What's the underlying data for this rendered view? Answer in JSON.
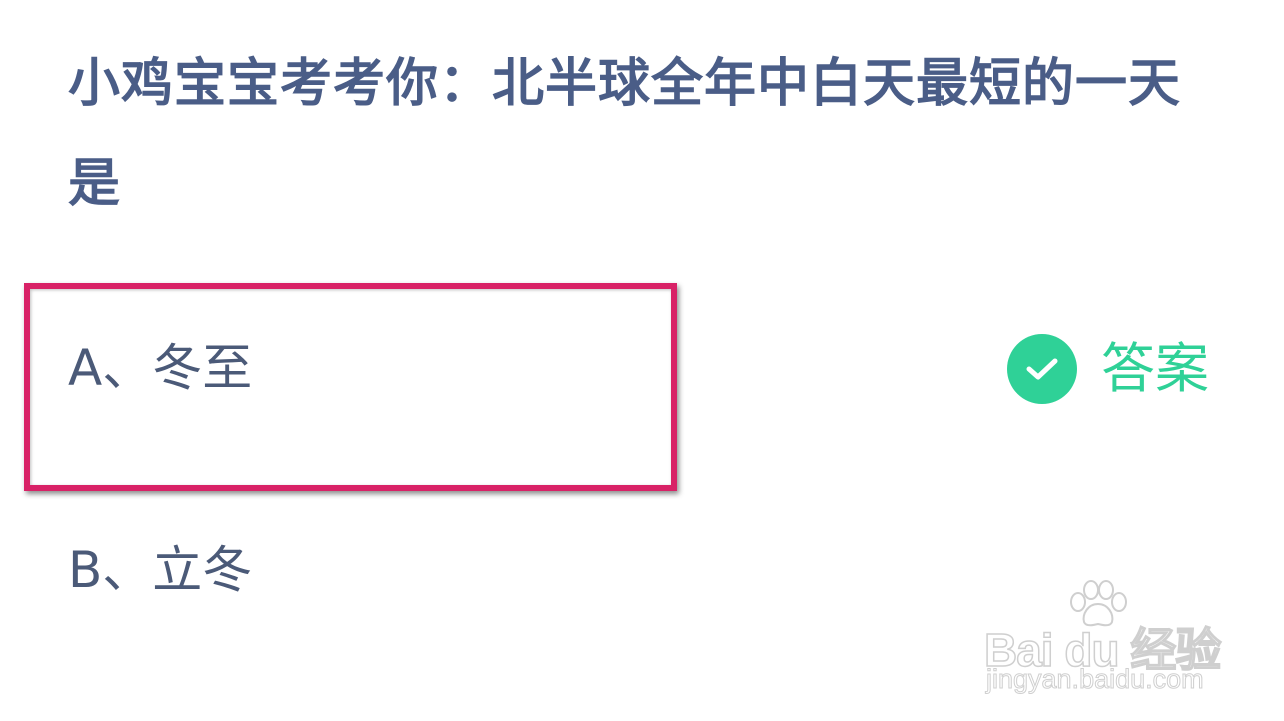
{
  "question": {
    "text": "小鸡宝宝考考你：北半球全年中白天最短的一天是"
  },
  "options": [
    {
      "letter": "A",
      "label": "A、冬至"
    },
    {
      "letter": "B",
      "label": "B、立冬"
    }
  ],
  "highlighted_option": "A",
  "answer": {
    "label": "答案",
    "icon": "check-circle-icon",
    "color": "#2fd197"
  },
  "highlight_color": "#d82166",
  "question_color": "#4a5d87",
  "watermark": {
    "brand": "Bai du 经验",
    "url": "jingyan.baidu.com"
  }
}
